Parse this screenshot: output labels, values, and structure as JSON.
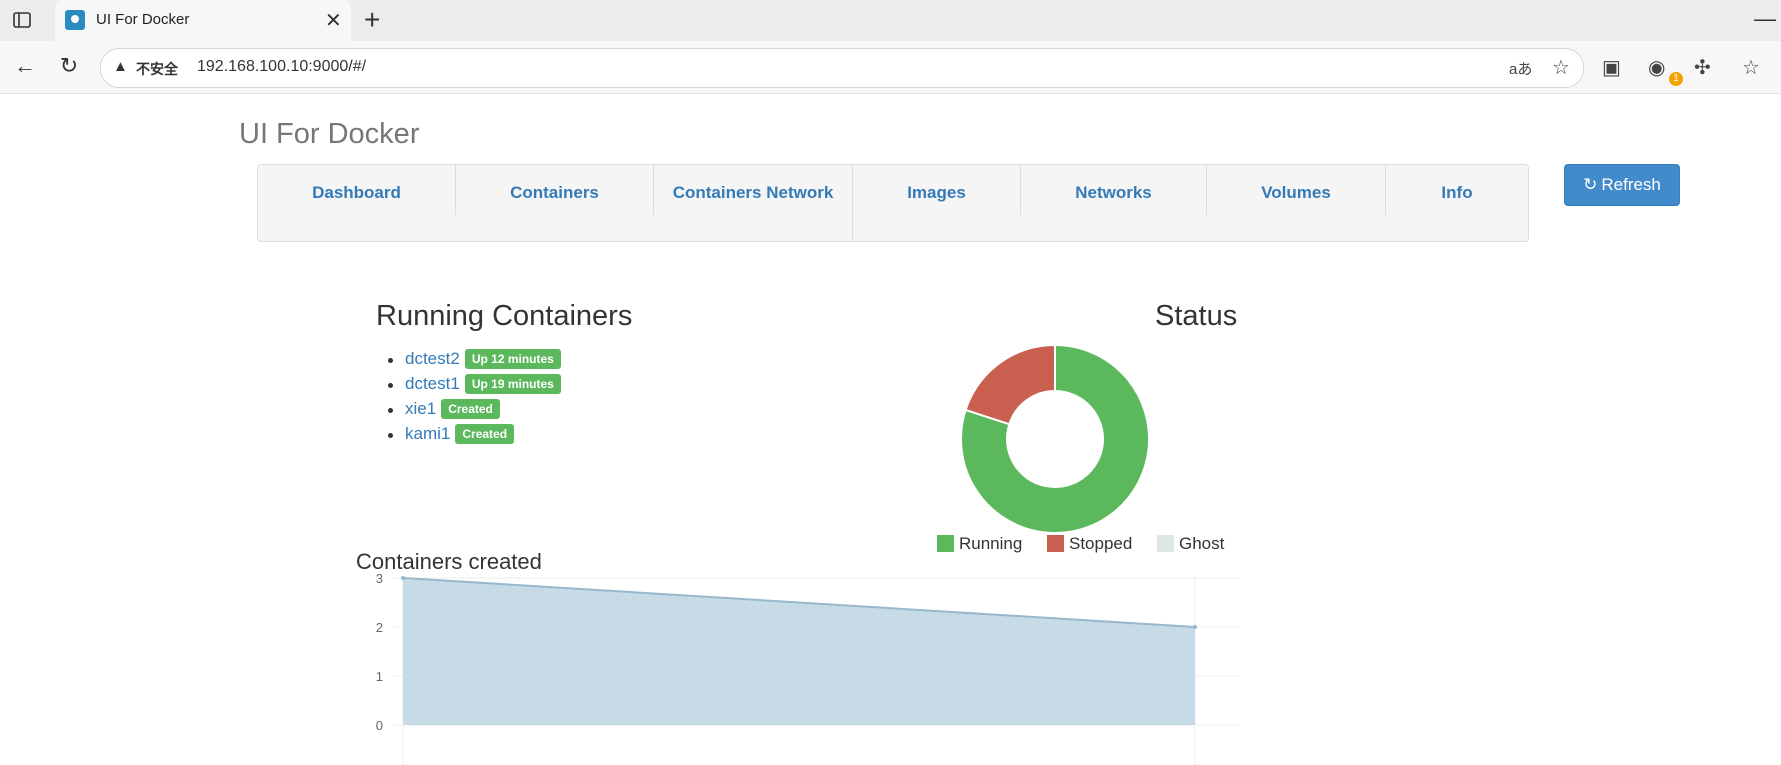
{
  "browser": {
    "tab_title": "UI For Docker",
    "security_label": "不安全",
    "url": "192.168.100.10:9000/#/",
    "read_aloud_label": "aあ",
    "extension_badge": "1"
  },
  "app": {
    "brand": "UI For Docker",
    "nav": [
      {
        "label": "Dashboard"
      },
      {
        "label": "Containers"
      },
      {
        "label": "Containers Network"
      },
      {
        "label": "Images"
      },
      {
        "label": "Networks"
      },
      {
        "label": "Volumes"
      },
      {
        "label": "Info"
      }
    ],
    "refresh_label": "Refresh"
  },
  "running": {
    "title": "Running Containers",
    "containers": [
      {
        "name": "dctest2",
        "status": "Up 12 minutes"
      },
      {
        "name": "dctest1",
        "status": "Up 19 minutes"
      },
      {
        "name": "xie1",
        "status": "Created"
      },
      {
        "name": "kami1",
        "status": "Created"
      }
    ]
  },
  "status": {
    "title": "Status",
    "colors": {
      "running": "#5cb85c",
      "stopped": "#c9604f",
      "ghost": "#dde8e6"
    }
  },
  "created_chart": {
    "title": "Containers created"
  },
  "chart_data": [
    {
      "type": "pie",
      "title": "Status",
      "categories": [
        "Running",
        "Stopped",
        "Ghost"
      ],
      "values": [
        4,
        1,
        0
      ],
      "colors": [
        "#5cb85c",
        "#c9604f",
        "#dde8e6"
      ],
      "legend": "bottom"
    },
    {
      "type": "area",
      "title": "Containers created",
      "x": [
        "",
        ""
      ],
      "series": [
        {
          "values": [
            3,
            2
          ]
        }
      ],
      "yticks": [
        0,
        1,
        2,
        3
      ],
      "ylim": [
        0,
        3
      ],
      "fill": "#c6dbe6",
      "stroke": "#97b8cc"
    }
  ]
}
